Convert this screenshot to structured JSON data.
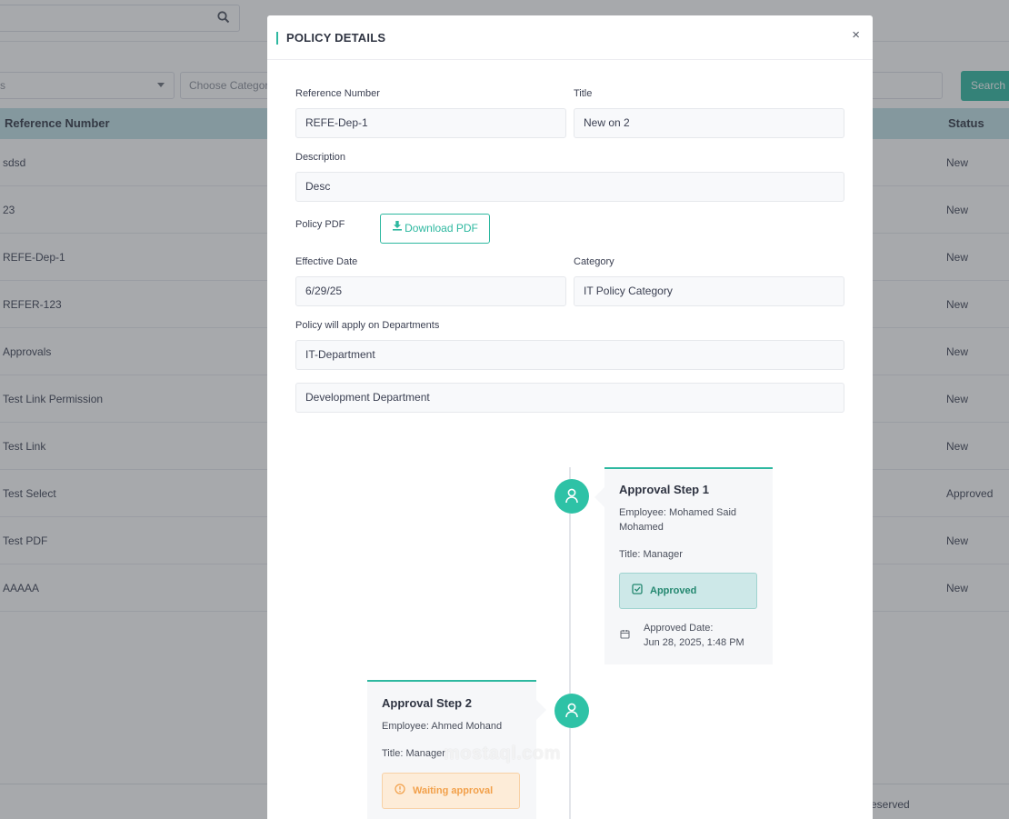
{
  "background": {
    "filter_select_1": "s",
    "filter_select_2": "Choose Categor",
    "search_button": "Search",
    "table": {
      "headers": [
        "Reference Number",
        "Status"
      ],
      "rows": [
        {
          "ref": "sdsd",
          "status": "New"
        },
        {
          "ref": "23",
          "status": "New"
        },
        {
          "ref": "REFE-Dep-1",
          "status": "New"
        },
        {
          "ref": "REFER-123",
          "status": "New"
        },
        {
          "ref": "Approvals",
          "status": "New"
        },
        {
          "ref": "Test Link Permission",
          "status": "New"
        },
        {
          "ref": "Test Link",
          "status": "New"
        },
        {
          "ref": "Test Select",
          "status": "Approved"
        },
        {
          "ref": "Test PDF",
          "status": "New"
        },
        {
          "ref": "AAAAA",
          "status": "New"
        }
      ]
    },
    "footer_text": "eserved"
  },
  "modal": {
    "title": "POLICY DETAILS",
    "close_label": "×",
    "reference_number": {
      "label": "Reference Number",
      "value": "REFE-Dep-1"
    },
    "title_field": {
      "label": "Title",
      "value": "New on 2"
    },
    "description": {
      "label": "Description",
      "value": "Desc"
    },
    "policy_pdf": {
      "label": "Policy PDF",
      "button_label": "Download PDF"
    },
    "effective_date": {
      "label": "Effective Date",
      "value": "6/29/25"
    },
    "category": {
      "label": "Category",
      "value": "IT Policy Category"
    },
    "departments": {
      "label": "Policy will apply on Departments",
      "items": [
        "IT-Department",
        "Development Department"
      ]
    },
    "approval_steps": [
      {
        "title": "Approval Step 1",
        "employee": "Employee: Mohamed Said Mohamed",
        "job_title": "Title: Manager",
        "status": "Approved",
        "date_label": "Approved Date:",
        "date_value": "Jun 28, 2025, 1:48 PM"
      },
      {
        "title": "Approval Step 2",
        "employee": "Employee: Ahmed Mohand",
        "job_title": "Title: Manager",
        "status": "Waiting approval"
      }
    ]
  },
  "watermark": "mostaql.com",
  "colors": {
    "accent": "#2eb8a0",
    "table_header": "#bfe0e6",
    "approved_bg": "#cde8e8",
    "waiting_bg": "#fdecd8",
    "waiting_text": "#f2a04a"
  }
}
